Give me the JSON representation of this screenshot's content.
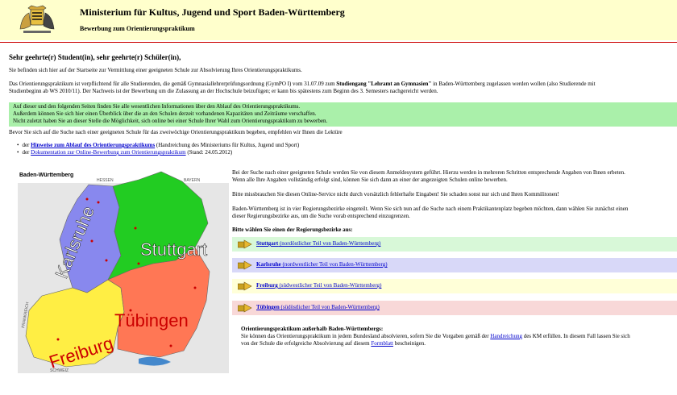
{
  "header": {
    "ministry": "Ministerium für Kultus, Jugend und Sport Baden-Württemberg",
    "subtitle": "Bewerbung zum Orientierungspraktikum"
  },
  "intro": {
    "greeting": "Sehr geehrte(r) Student(in), sehr geehrte(r) Schüler(in),",
    "p1": "Sie befinden sich hier auf der Startseite zur Vermittlung einer geeigneten Schule zur Absolvierung Ihres Orientierungspraktikums.",
    "p2_part1": "Das Orientierungspraktikum ist verpflichtend für alle Studierenden, die gemäß Gymnasiallehrerprüfungsordnung (GymPO I) vom 31.07.09 zum ",
    "p2_bold": "Studiengang \"Lehramt an Gymnasien\"",
    "p2_part2": " in Baden-Württemberg zugelassen werden wollen (also Studierende mit",
    "p2_line2": "Studienbeginn ab WS 2010/11). Der Nachweis ist der Bewerbung um die Zulassung an der Hochschule beizufügen; er kann bis spätestens zum Beginn des 3. Semesters nachgereicht werden.",
    "green_lines": [
      "Auf dieser und den folgenden Seiten finden Sie alle wesentlichen Informationen über den Ablauf des Orientierungspraktikums.",
      "Außerdem können Sie sich hier einen Überblick über die an den Schulen derzeit vorhandenen Kapazitäten und Zeiträume verschaffen.",
      "Nicht zuletzt haben Sie an dieser Stelle die Möglichkeit, sich online bei einer Schule Ihrer Wahl zum Orientierungspraktikum zu bewerben."
    ],
    "p4": "Bevor Sie sich auf die Suche nach einer geeigneten Schule für das zweiwöchige Orientierungspraktikum begeben, empfehlen wir Ihnen die Lektüre"
  },
  "links": [
    {
      "prefix": "der ",
      "link": "Hinweise zum Ablauf des Orientierungspraktikums",
      "suffix": " (Handreichung des Ministeriums für Kultus, Jugend und Sport)"
    },
    {
      "prefix": "der ",
      "link": "Dokumentation zur Online-Bewerbung zum Orientierungspraktikum",
      "suffix": " (Stand: 24.05.2012)"
    }
  ],
  "map": {
    "title": "Baden-Württemberg",
    "regions": [
      "Stuttgart",
      "Karlsruhe",
      "Freiburg",
      "Tübingen"
    ],
    "neighbors": [
      "HESSEN",
      "BAYERN",
      "FRANKREICH",
      "SCHWEIZ"
    ],
    "areas": [
      "RHEIN NECKAR ODENWALD",
      "HEILBRONN FRANKEN",
      "OSTWÜRTTEMBERG",
      "NORDSCHWARZWALD",
      "MITTLERER OBERRHEIN",
      "SÜDLICHER OBERRHEIN",
      "SCHWARZWALD BAAR-HEUBERG",
      "HOCHRHEIN BODENSEE",
      "NECKAR-ALB",
      "DONAU-ILLER",
      "BODENSEE OBERSCHWABEN"
    ],
    "cities": [
      "Mannheim",
      "Heidelberg",
      "Heilbronn",
      "Karlsruhe",
      "Pforzheim",
      "Baden-Baden",
      "Stuttgart",
      "Ulm",
      "Freiburg im Breisgau",
      "Tübingen",
      "Ravensburg"
    ]
  },
  "right": {
    "p1_line1": "Bei der Suche nach einer geeigneten Schule werden Sie von diesem Anmeldesystem geführt. Hierzu werden in mehreren Schritten entsprechende Angaben von Ihnen erbeten.",
    "p1_line2": "Wenn alle Ihre Angaben vollständig erfolgt sind, können Sie sich dann an einer der angezeigten Schulen online bewerben.",
    "p2": "Bitte missbrauchen Sie diesen Online-Service nicht durch vorsätzlich fehlerhafte Eingaben! Sie schaden sonst nur sich und Ihren Kommilitonen!",
    "p3_line1": "Baden-Württemberg ist in vier Regierungsbezirke eingeteilt. Wenn Sie sich nun auf die Suche nach einem Praktikantenplatz begeben möchten, dann wählen Sie zunächst einen",
    "p3_line2": "dieser Regierungsbezirke aus, um die Suche vorab entsprechend einzugrenzen.",
    "choose": "Bitte wählen Sie einen der Regierungsbezirke aus:"
  },
  "regions": [
    {
      "name": "Stuttgart",
      "desc": " (nordöstlicher Teil von Baden-Württemberg)"
    },
    {
      "name": "Karlsruhe",
      "desc": " (nordwestlicher Teil von Baden-Württemberg)"
    },
    {
      "name": "Freiburg",
      "desc": " (südwestlicher Teil von Baden-Württemberg)"
    },
    {
      "name": "Tübingen",
      "desc": " (südöstlicher Teil von Baden-Württemberg)"
    }
  ],
  "outside": {
    "title": "Orientierungspraktikum außerhalb Baden-Württembergs:",
    "line1_part1": "Sie können das Orientierungspraktikum in jedem Bundesland absolvieren, sofern Sie die Vorgaben gemäß der ",
    "line1_link": "Handreichung",
    "line1_part2": " des KM erfüllen. In diesem Fall lassen Sie sich",
    "line2_part1": "von der Schule die erfolgreiche Absolvierung auf diesem ",
    "line2_link": "Formblatt",
    "line2_part2": " bescheinigen."
  },
  "colors": {
    "header_bg": "#ffffcc",
    "green_box": "#aaf0aa",
    "stuttgart": "#22cc22",
    "karlsruhe": "#8888ee",
    "freiburg": "#ffee44",
    "tuebingen": "#ff7755",
    "link": "#0000cc"
  }
}
